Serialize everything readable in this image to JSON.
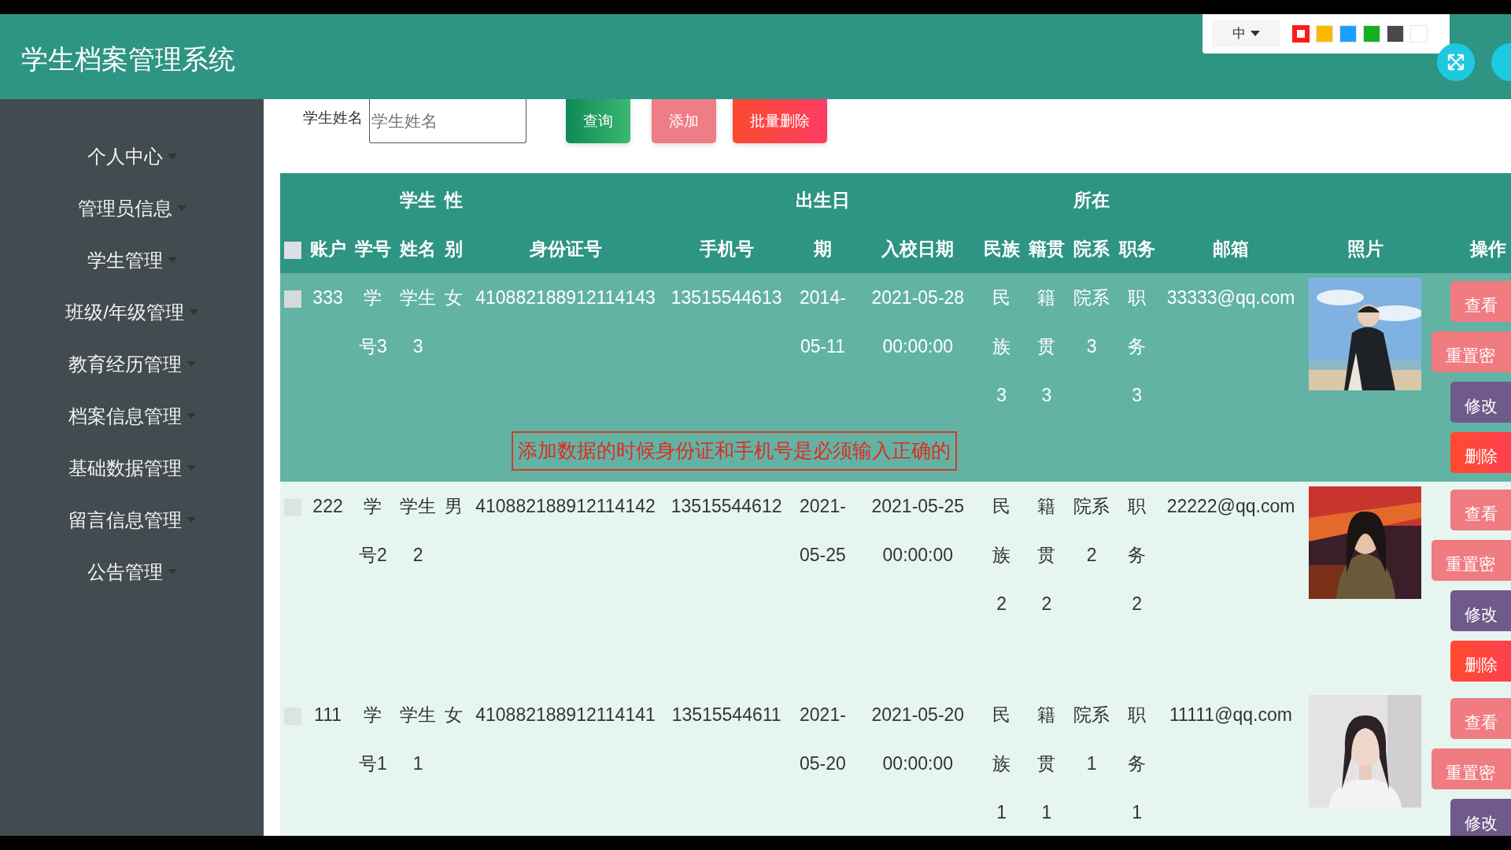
{
  "header": {
    "title": "学生档案管理系统",
    "language": "中",
    "swatches": [
      {
        "color": "#ff1a1a",
        "selected": true
      },
      {
        "color": "#ffb800",
        "selected": false
      },
      {
        "color": "#1e9fff",
        "selected": false
      },
      {
        "color": "#16b024",
        "selected": false
      },
      {
        "color": "#4a4a4a",
        "selected": false
      },
      {
        "color": "#ffffff",
        "selected": false
      }
    ]
  },
  "sidebar": {
    "items": [
      {
        "label": "个人中心"
      },
      {
        "label": "管理员信息"
      },
      {
        "label": "学生管理"
      },
      {
        "label": "班级/年级管理"
      },
      {
        "label": "教育经历管理"
      },
      {
        "label": "档案信息管理"
      },
      {
        "label": "基础数据管理"
      },
      {
        "label": "留言信息管理"
      },
      {
        "label": "公告管理"
      }
    ]
  },
  "search": {
    "label": "学生姓名",
    "placeholder": "学生姓名",
    "buttons": [
      {
        "label": "查询",
        "kind": "query"
      },
      {
        "label": "添加",
        "kind": "add"
      },
      {
        "label": "批量删除",
        "kind": "bulk-delete"
      }
    ]
  },
  "table": {
    "select_all": {
      "checked": false
    },
    "columns": [
      "账户",
      "学号",
      "学生姓名",
      "性别",
      "身份证号",
      "手机号",
      "出生日期",
      "入校日期",
      "民族",
      "籍贯",
      "所在院系",
      "职务",
      "邮箱",
      "照片",
      "操作"
    ],
    "rows": [
      {
        "checked": false,
        "hovered": true,
        "cells": [
          "333",
          "学号3",
          "学生3",
          "女",
          "410882188912114143",
          "13515544613",
          "2014-05-11",
          "2021-05-28 00:00:00",
          "民族3",
          "籍贯3",
          "院系3",
          "职务3",
          "33333@qq.com"
        ],
        "photo": {
          "kind": "picture"
        },
        "actions": [
          {
            "label": "查看",
            "kind": "view"
          },
          {
            "label": "重置密",
            "kind": "reset"
          },
          {
            "label": "修改",
            "kind": "edit"
          },
          {
            "label": "删除",
            "kind": "delete"
          }
        ]
      },
      {
        "checked": false,
        "hovered": false,
        "cells": [
          "222",
          "学号2",
          "学生2",
          "男",
          "410882188912114142",
          "13515544612",
          "2021-05-25",
          "2021-05-25 00:00:00",
          "民族2",
          "籍贯2",
          "院系2",
          "职务2",
          "22222@qq.com"
        ],
        "photo": {
          "kind": "picture"
        },
        "actions": [
          {
            "label": "查看",
            "kind": "view"
          },
          {
            "label": "重置密",
            "kind": "reset"
          },
          {
            "label": "修改",
            "kind": "edit"
          },
          {
            "label": "删除",
            "kind": "delete"
          }
        ]
      },
      {
        "checked": false,
        "hovered": false,
        "cells": [
          "111",
          "学号1",
          "学生1",
          "女",
          "410882188912114141",
          "13515544611",
          "2021-05-20",
          "2021-05-20 00:00:00",
          "民族1",
          "籍贯1",
          "院系1",
          "职务1",
          "11111@qq.com"
        ],
        "photo": {
          "kind": "picture"
        },
        "actions": [
          {
            "label": "查看",
            "kind": "view"
          },
          {
            "label": "重置密",
            "kind": "reset"
          },
          {
            "label": "修改",
            "kind": "edit"
          }
        ]
      }
    ]
  },
  "annotation": {
    "text": "添加数据的时候身份证和手机号是必须输入正确的"
  }
}
